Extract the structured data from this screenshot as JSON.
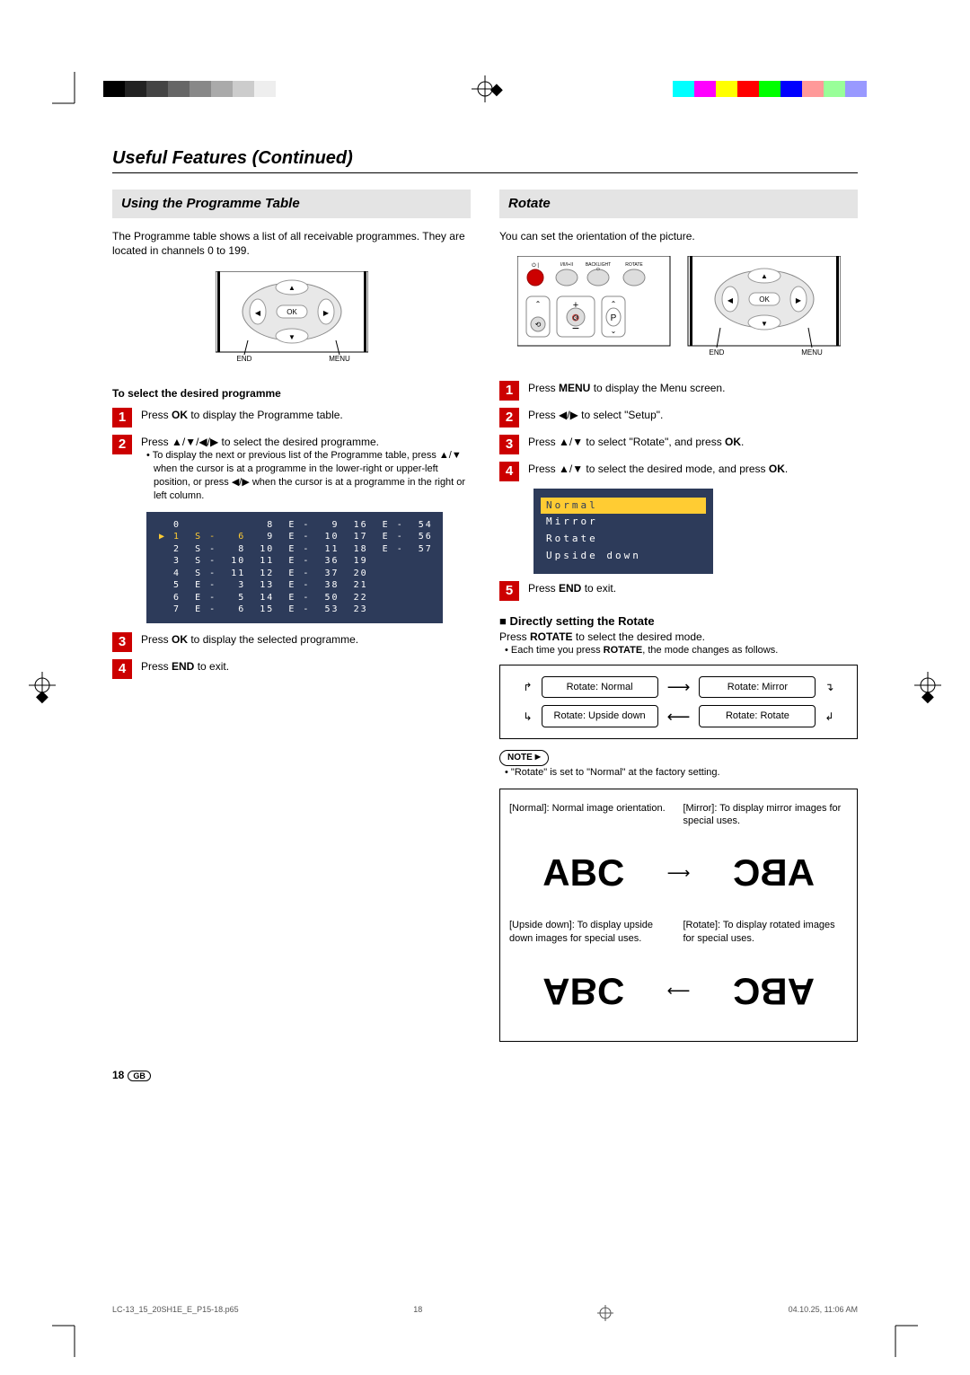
{
  "pageTitle": "Useful Features (Continued)",
  "left": {
    "heading": "Using the Programme Table",
    "intro": "The Programme table shows a list of all receivable programmes. They are located in channels 0 to 199.",
    "selectHeading": "To select the desired programme",
    "step1": {
      "pre": "Press ",
      "bold": "OK",
      "post": " to display the Programme table."
    },
    "step2": {
      "text": "Press ▲/▼/◀/▶ to select the desired programme."
    },
    "step2note": "To display the next or previous list of the Programme table, press ▲/▼ when the cursor is at a programme in the lower-right or upper-left position, or press ◀/▶ when the cursor is at a programme in the right or left column.",
    "step3": {
      "pre": "Press ",
      "bold": "OK",
      "post": " to display the selected programme."
    },
    "step4": {
      "pre": "Press ",
      "bold": "END",
      "post": " to exit."
    },
    "table": {
      "col1": [
        "0",
        "1  S -   6",
        "2  S -   8",
        "3  S -  10",
        "4  S -  11",
        "5  E -   3",
        "6  E -   5",
        "7  E -   6"
      ],
      "col2": [
        " 8  E -   9",
        " 9  E -  10",
        "10  E -  11",
        "11  E -  36",
        "12  E -  37",
        "13  E -  38",
        "14  E -  50",
        "15  E -  53"
      ],
      "col3": [
        "16  E -  54",
        "17  E -  56",
        "18  E -  57",
        "19",
        "20",
        "21",
        "22",
        "23"
      ]
    },
    "remoteLabels": {
      "ok": "OK",
      "end": "END",
      "menu": "MENU"
    }
  },
  "right": {
    "heading": "Rotate",
    "intro": "You can set the orientation of the picture.",
    "step1": {
      "pre": "Press ",
      "bold": "MENU",
      "post": " to display the Menu screen."
    },
    "step2": "Press ◀/▶ to select \"Setup\".",
    "step3": {
      "pre": "Press ▲/▼ to select \"Rotate\", and press ",
      "bold": "OK",
      "post": "."
    },
    "step4": {
      "pre": "Press ▲/▼ to select the desired mode, and press ",
      "bold": "OK",
      "post": "."
    },
    "step5": {
      "pre": "Press ",
      "bold": "END",
      "post": " to exit."
    },
    "modes": [
      "Normal",
      "Mirror",
      "Rotate",
      "Upside down"
    ],
    "directHeading": "Directly setting the Rotate",
    "directText": {
      "pre": "Press ",
      "bold": "ROTATE",
      "post": " to select the desired mode."
    },
    "directBullet": {
      "pre": "Each time you press ",
      "bold": "ROTATE",
      "post": ", the mode changes as follows."
    },
    "flow": {
      "normal": "Rotate: Normal",
      "mirror": "Rotate: Mirror",
      "upside": "Rotate: Upside down",
      "rotate": "Rotate: Rotate"
    },
    "noteLabel": "NOTE",
    "noteText": "\"Rotate\" is set to \"Normal\" at the factory setting.",
    "abc": {
      "normalDesc": "[Normal]: Normal image orientation.",
      "mirrorDesc": "[Mirror]: To display mirror images for special uses.",
      "upsideDesc": "[Upside down]: To display upside down images for special uses.",
      "rotateDesc": "[Rotate]: To display rotated images for special uses.",
      "text": "ABC"
    },
    "topButtons": {
      "b1": "I/II/I+II",
      "b2": "BACKLIGHT",
      "b3": "ROTATE",
      "p": "P"
    },
    "remoteLabels": {
      "ok": "OK",
      "end": "END",
      "menu": "MENU"
    }
  },
  "pageNum": "18",
  "pageLang": "GB",
  "footer": {
    "file": "LC-13_15_20SH1E_E_P15-18.p65",
    "pg": "18",
    "date": "04.10.25, 11:06 AM"
  }
}
